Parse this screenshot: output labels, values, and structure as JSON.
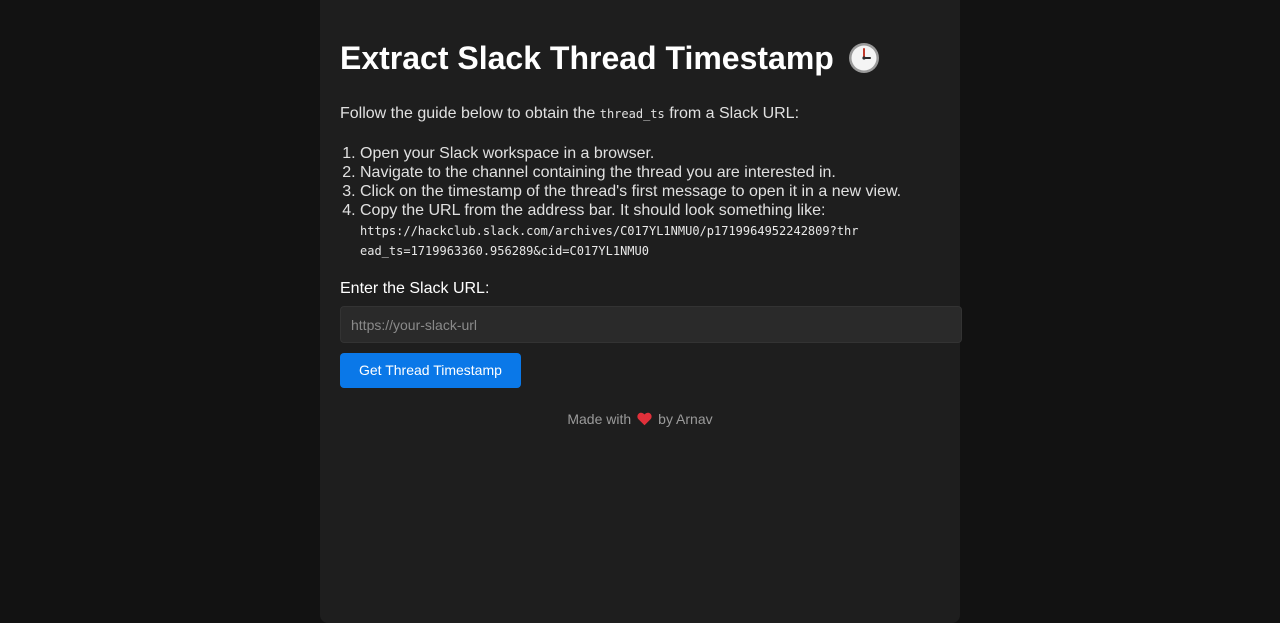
{
  "header": {
    "title": "Extract Slack Thread Timestamp",
    "icon": "clock-icon"
  },
  "intro": {
    "before": "Follow the guide below to obtain the ",
    "code": "thread_ts",
    "after": " from a Slack URL:"
  },
  "steps": [
    "Open your Slack workspace in a browser.",
    "Navigate to the channel containing the thread you are interested in.",
    "Click on the timestamp of the thread's first message to open it in a new view.",
    "Copy the URL from the address bar. It should look something like:"
  ],
  "example_url": "https://hackclub.slack.com/archives/C017YL1NMU0/p1719964952242809?thread_ts=1719963360.956289&cid=C017YL1NMU0",
  "form": {
    "label": "Enter the Slack URL:",
    "placeholder": "https://your-slack-url",
    "value": "",
    "button_label": "Get Thread Timestamp"
  },
  "footer": {
    "before": "Made with",
    "icon": "heart-icon",
    "after": "by Arnav"
  },
  "colors": {
    "page_bg": "#121212",
    "card_bg": "#1e1e1e",
    "accent": "#0a78e8",
    "heart": "#e0303a"
  }
}
